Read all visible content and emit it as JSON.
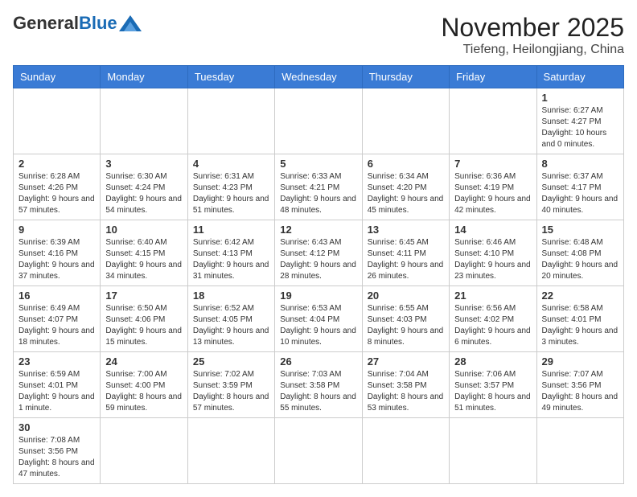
{
  "header": {
    "logo_general": "General",
    "logo_blue": "Blue",
    "month_title": "November 2025",
    "location": "Tiefeng, Heilongjiang, China"
  },
  "weekdays": [
    "Sunday",
    "Monday",
    "Tuesday",
    "Wednesday",
    "Thursday",
    "Friday",
    "Saturday"
  ],
  "weeks": [
    [
      {
        "day": "",
        "info": ""
      },
      {
        "day": "",
        "info": ""
      },
      {
        "day": "",
        "info": ""
      },
      {
        "day": "",
        "info": ""
      },
      {
        "day": "",
        "info": ""
      },
      {
        "day": "",
        "info": ""
      },
      {
        "day": "1",
        "info": "Sunrise: 6:27 AM\nSunset: 4:27 PM\nDaylight: 10 hours and 0 minutes."
      }
    ],
    [
      {
        "day": "2",
        "info": "Sunrise: 6:28 AM\nSunset: 4:26 PM\nDaylight: 9 hours and 57 minutes."
      },
      {
        "day": "3",
        "info": "Sunrise: 6:30 AM\nSunset: 4:24 PM\nDaylight: 9 hours and 54 minutes."
      },
      {
        "day": "4",
        "info": "Sunrise: 6:31 AM\nSunset: 4:23 PM\nDaylight: 9 hours and 51 minutes."
      },
      {
        "day": "5",
        "info": "Sunrise: 6:33 AM\nSunset: 4:21 PM\nDaylight: 9 hours and 48 minutes."
      },
      {
        "day": "6",
        "info": "Sunrise: 6:34 AM\nSunset: 4:20 PM\nDaylight: 9 hours and 45 minutes."
      },
      {
        "day": "7",
        "info": "Sunrise: 6:36 AM\nSunset: 4:19 PM\nDaylight: 9 hours and 42 minutes."
      },
      {
        "day": "8",
        "info": "Sunrise: 6:37 AM\nSunset: 4:17 PM\nDaylight: 9 hours and 40 minutes."
      }
    ],
    [
      {
        "day": "9",
        "info": "Sunrise: 6:39 AM\nSunset: 4:16 PM\nDaylight: 9 hours and 37 minutes."
      },
      {
        "day": "10",
        "info": "Sunrise: 6:40 AM\nSunset: 4:15 PM\nDaylight: 9 hours and 34 minutes."
      },
      {
        "day": "11",
        "info": "Sunrise: 6:42 AM\nSunset: 4:13 PM\nDaylight: 9 hours and 31 minutes."
      },
      {
        "day": "12",
        "info": "Sunrise: 6:43 AM\nSunset: 4:12 PM\nDaylight: 9 hours and 28 minutes."
      },
      {
        "day": "13",
        "info": "Sunrise: 6:45 AM\nSunset: 4:11 PM\nDaylight: 9 hours and 26 minutes."
      },
      {
        "day": "14",
        "info": "Sunrise: 6:46 AM\nSunset: 4:10 PM\nDaylight: 9 hours and 23 minutes."
      },
      {
        "day": "15",
        "info": "Sunrise: 6:48 AM\nSunset: 4:08 PM\nDaylight: 9 hours and 20 minutes."
      }
    ],
    [
      {
        "day": "16",
        "info": "Sunrise: 6:49 AM\nSunset: 4:07 PM\nDaylight: 9 hours and 18 minutes."
      },
      {
        "day": "17",
        "info": "Sunrise: 6:50 AM\nSunset: 4:06 PM\nDaylight: 9 hours and 15 minutes."
      },
      {
        "day": "18",
        "info": "Sunrise: 6:52 AM\nSunset: 4:05 PM\nDaylight: 9 hours and 13 minutes."
      },
      {
        "day": "19",
        "info": "Sunrise: 6:53 AM\nSunset: 4:04 PM\nDaylight: 9 hours and 10 minutes."
      },
      {
        "day": "20",
        "info": "Sunrise: 6:55 AM\nSunset: 4:03 PM\nDaylight: 9 hours and 8 minutes."
      },
      {
        "day": "21",
        "info": "Sunrise: 6:56 AM\nSunset: 4:02 PM\nDaylight: 9 hours and 6 minutes."
      },
      {
        "day": "22",
        "info": "Sunrise: 6:58 AM\nSunset: 4:01 PM\nDaylight: 9 hours and 3 minutes."
      }
    ],
    [
      {
        "day": "23",
        "info": "Sunrise: 6:59 AM\nSunset: 4:01 PM\nDaylight: 9 hours and 1 minute."
      },
      {
        "day": "24",
        "info": "Sunrise: 7:00 AM\nSunset: 4:00 PM\nDaylight: 8 hours and 59 minutes."
      },
      {
        "day": "25",
        "info": "Sunrise: 7:02 AM\nSunset: 3:59 PM\nDaylight: 8 hours and 57 minutes."
      },
      {
        "day": "26",
        "info": "Sunrise: 7:03 AM\nSunset: 3:58 PM\nDaylight: 8 hours and 55 minutes."
      },
      {
        "day": "27",
        "info": "Sunrise: 7:04 AM\nSunset: 3:58 PM\nDaylight: 8 hours and 53 minutes."
      },
      {
        "day": "28",
        "info": "Sunrise: 7:06 AM\nSunset: 3:57 PM\nDaylight: 8 hours and 51 minutes."
      },
      {
        "day": "29",
        "info": "Sunrise: 7:07 AM\nSunset: 3:56 PM\nDaylight: 8 hours and 49 minutes."
      }
    ],
    [
      {
        "day": "30",
        "info": "Sunrise: 7:08 AM\nSunset: 3:56 PM\nDaylight: 8 hours and 47 minutes."
      },
      {
        "day": "",
        "info": ""
      },
      {
        "day": "",
        "info": ""
      },
      {
        "day": "",
        "info": ""
      },
      {
        "day": "",
        "info": ""
      },
      {
        "day": "",
        "info": ""
      },
      {
        "day": "",
        "info": ""
      }
    ]
  ]
}
